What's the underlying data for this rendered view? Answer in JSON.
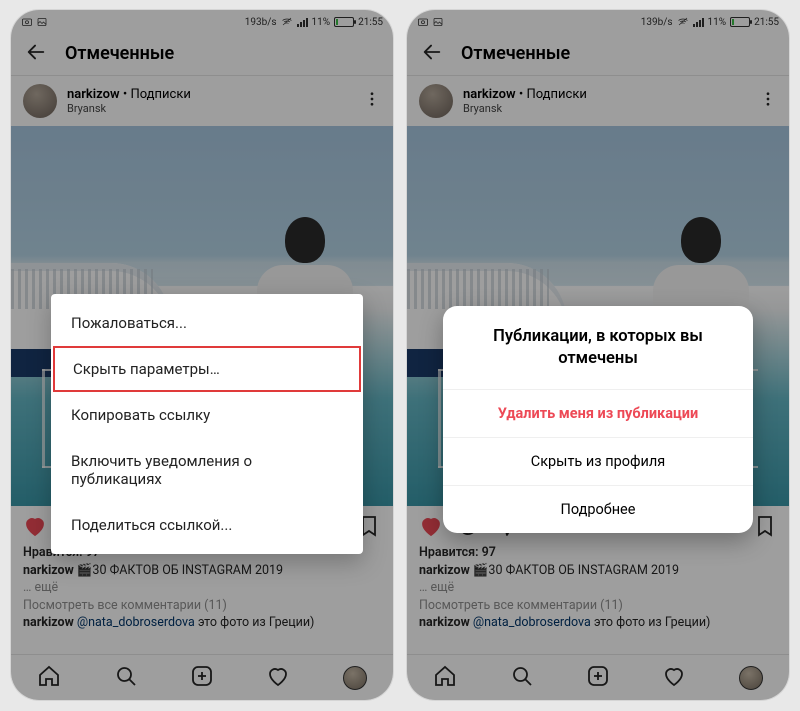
{
  "status": {
    "speed_left": "193b/s",
    "speed_right": "139b/s",
    "battery_pct": "11%",
    "time": "21:55",
    "time_right": "21:55"
  },
  "header": {
    "title": "Отмеченные"
  },
  "post": {
    "username": "narkizow",
    "follow_sep": " • ",
    "follow": "Подписки",
    "location": "Bryansk"
  },
  "actions": {
    "dots_indicator": "• • •"
  },
  "meta": {
    "likes_label": "Нравится: ",
    "likes_count": "97",
    "caption_user": "narkizow",
    "caption_text": " 🎬30 ФАКТОВ ОБ INSTAGRAM 2019",
    "more": "… ещё",
    "view_all_prefix": "Посмотреть все комментарии (",
    "view_all_count": "11",
    "view_all_suffix": ")",
    "comment_user": "narkizow",
    "comment_mention": "@nata_dobroserdova",
    "comment_rest": " это фото из Греции)"
  },
  "popup_left": {
    "items": [
      "Пожаловаться...",
      "Скрыть параметры…",
      "Копировать ссылку",
      "Включить уведомления о публикациях",
      "Поделиться ссылкой..."
    ]
  },
  "popup_right": {
    "title": "Публикации, в которых вы отмечены",
    "items": [
      "Удалить меня из публикации",
      "Скрыть из профиля",
      "Подробнее"
    ]
  }
}
